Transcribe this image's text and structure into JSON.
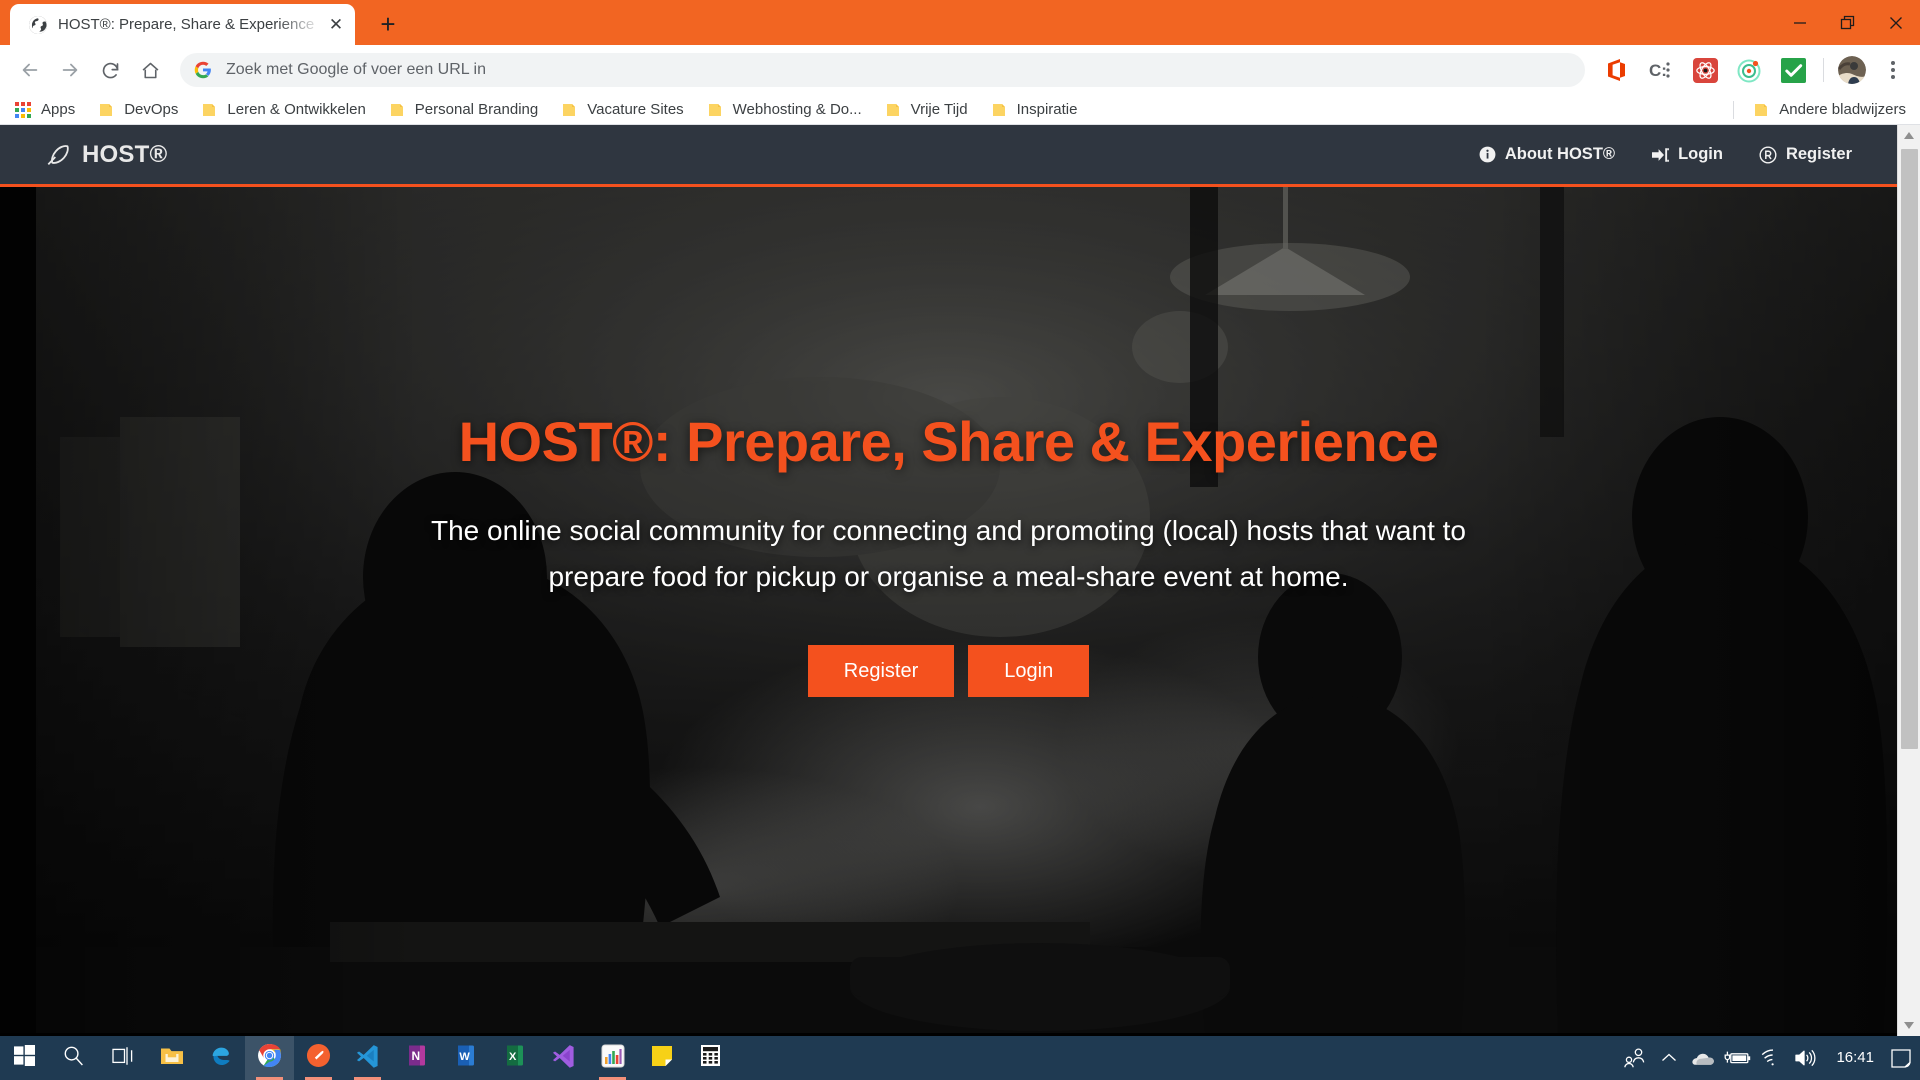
{
  "browser": {
    "tab": {
      "title": "HOST®: Prepare, Share & Experience",
      "favicon_name": "globe-favicon",
      "close_label": "✕"
    },
    "new_tab_label": "+",
    "window_controls": [
      {
        "name": "minimize-button",
        "label": "—"
      },
      {
        "name": "restore-button",
        "label": "❐"
      },
      {
        "name": "close-button",
        "label": "✕"
      }
    ],
    "omnibox": {
      "value": "",
      "placeholder": "Zoek met Google of voer een URL in",
      "search_engine_icon": "google-g-icon"
    },
    "nav_buttons": [
      {
        "name": "back-button",
        "label": "←"
      },
      {
        "name": "forward-button",
        "label": "→"
      },
      {
        "name": "reload-button",
        "label": "⟳"
      },
      {
        "name": "home-button",
        "label": "⌂"
      }
    ],
    "extensions": [
      {
        "name": "microsoft-office-extension-icon",
        "title": "Office"
      },
      {
        "name": "clockify-extension-icon",
        "title": "C:"
      },
      {
        "name": "react-devtools-extension-icon",
        "title": "React Developer Tools"
      },
      {
        "name": "target-tracker-extension-icon",
        "title": "Tracker"
      },
      {
        "name": "checkmark-extension-icon",
        "title": "Check"
      }
    ],
    "profile_name": "profile-avatar",
    "menu_name": "chrome-menu-button",
    "bookmarks": [
      {
        "label": "Apps",
        "icon": "apps-grid-icon"
      },
      {
        "label": "DevOps",
        "icon": "folder-icon"
      },
      {
        "label": "Leren & Ontwikkelen",
        "icon": "folder-icon"
      },
      {
        "label": "Personal Branding",
        "icon": "folder-icon"
      },
      {
        "label": "Vacature Sites",
        "icon": "folder-icon"
      },
      {
        "label": "Webhosting & Do...",
        "icon": "folder-icon"
      },
      {
        "label": "Vrije Tijd",
        "icon": "folder-icon"
      },
      {
        "label": "Inspiratie",
        "icon": "folder-icon"
      }
    ],
    "other_bookmarks": {
      "label": "Andere bladwijzers",
      "icon": "folder-icon"
    }
  },
  "site": {
    "brand": {
      "text": "HOST®",
      "logo_icon": "lemon-outline-icon"
    },
    "nav": [
      {
        "label": "About HOST®",
        "icon": "info-circle-icon"
      },
      {
        "label": "Login",
        "icon": "sign-in-icon"
      },
      {
        "label": "Register",
        "icon": "registered-mark-icon"
      }
    ],
    "hero": {
      "title": "HOST®: Prepare, Share & Experience",
      "subtitle_line1": "The online social community for connecting and promoting (local) hosts that",
      "subtitle_line2": "want to prepare food for pickup or organise a meal-share event at home.",
      "primary_button": "Register",
      "secondary_button": "Login"
    },
    "colors": {
      "accent": "#f4511e",
      "header_bg": "#2f3640",
      "hero_text": "#ffffff"
    }
  },
  "taskbar": {
    "items": [
      {
        "name": "start-button",
        "icon": "windows-logo-icon",
        "active": false
      },
      {
        "name": "search-button",
        "icon": "magnifier-icon",
        "active": false
      },
      {
        "name": "task-view-button",
        "icon": "task-view-icon",
        "active": false
      },
      {
        "name": "file-explorer",
        "icon": "folder-icon",
        "active": false
      },
      {
        "name": "microsoft-edge",
        "icon": "edge-icon",
        "active": false
      },
      {
        "name": "google-chrome",
        "icon": "chrome-icon",
        "active": true
      },
      {
        "name": "postman",
        "icon": "postman-icon",
        "active": true
      },
      {
        "name": "visual-studio-code",
        "icon": "vscode-icon",
        "active": true
      },
      {
        "name": "microsoft-onenote",
        "icon": "onenote-icon",
        "active": false
      },
      {
        "name": "microsoft-word",
        "icon": "word-icon",
        "active": false
      },
      {
        "name": "microsoft-excel",
        "icon": "excel-icon",
        "active": false
      },
      {
        "name": "visual-studio",
        "icon": "visual-studio-icon",
        "active": false
      },
      {
        "name": "chart-app",
        "icon": "chart-icon",
        "active": true
      },
      {
        "name": "sticky-notes",
        "icon": "sticky-note-icon",
        "active": false
      },
      {
        "name": "calculator",
        "icon": "calculator-icon",
        "active": false
      }
    ],
    "tray": [
      {
        "name": "people-icon",
        "label": ""
      },
      {
        "name": "show-hidden-icons-chevron",
        "label": ""
      },
      {
        "name": "onedrive-icon",
        "label": ""
      },
      {
        "name": "battery-charging-icon",
        "label": ""
      },
      {
        "name": "wifi-icon",
        "label": ""
      },
      {
        "name": "volume-icon",
        "label": ""
      }
    ],
    "clock": "16:41",
    "notifications_name": "action-center-icon"
  }
}
